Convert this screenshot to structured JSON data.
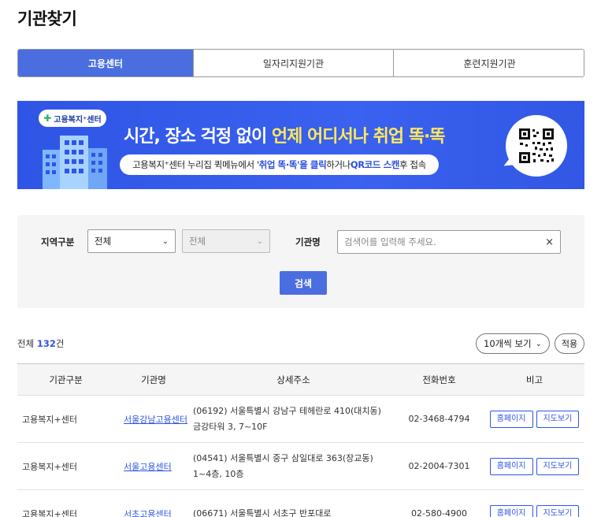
{
  "page_title": "기관찾기",
  "tabs": [
    {
      "label": "고용센터",
      "active": true
    },
    {
      "label": "일자리지원기관",
      "active": false
    },
    {
      "label": "훈련지원기관",
      "active": false
    }
  ],
  "banner": {
    "badge": "고용복지⁺센터",
    "headline_a": "시간, 장소 걱정 없이 ",
    "headline_b": "언제 어디서나 취업 똑·똑",
    "sub_a": "고용복지⁺센터 누리집 퀵메뉴에서 '",
    "sub_b": "취업 똑·똑",
    "sub_c": "'을 클릭",
    "sub_d": "하거나 ",
    "sub_e": "QR코드 스캔",
    "sub_f": " 후 접속"
  },
  "search": {
    "region_label": "지역구분",
    "region_value": "전체",
    "subregion_value": "전체",
    "name_label": "기관명",
    "name_placeholder": "검색어를 입력해 주세요.",
    "clear_symbol": "×",
    "search_button": "검색"
  },
  "results": {
    "total_prefix": "전체 ",
    "total_count": "132",
    "total_suffix": "건",
    "page_size": "10개씩 보기",
    "apply_button": "적용"
  },
  "table": {
    "headers": [
      "기관구분",
      "기관명",
      "상세주소",
      "전화번호",
      "비고"
    ],
    "homepage_label": "홈페이지",
    "map_label": "지도보기",
    "rows": [
      {
        "type": "고용복지+센터",
        "name": "서울강남고용센터",
        "address": "(06192) 서울특별시 강남구 테헤란로 410(대치동) 금강타워 3, 7~10F",
        "tel": "02-3468-4794"
      },
      {
        "type": "고용복지+센터",
        "name": "서울고용센터",
        "address": "(04541) 서울특별시 중구 삼일대로 363(장교동) 1~4층, 10층",
        "tel": "02-2004-7301"
      },
      {
        "type": "고용복지+센터",
        "name": "서초고용센터",
        "address": "(06671) 서울특별시 서초구 반포대로",
        "tel": "02-580-4900"
      }
    ]
  },
  "colors": {
    "accent": "#4a6ee0",
    "banner_bg": "#3157e4",
    "highlight": "#ffe95a"
  }
}
